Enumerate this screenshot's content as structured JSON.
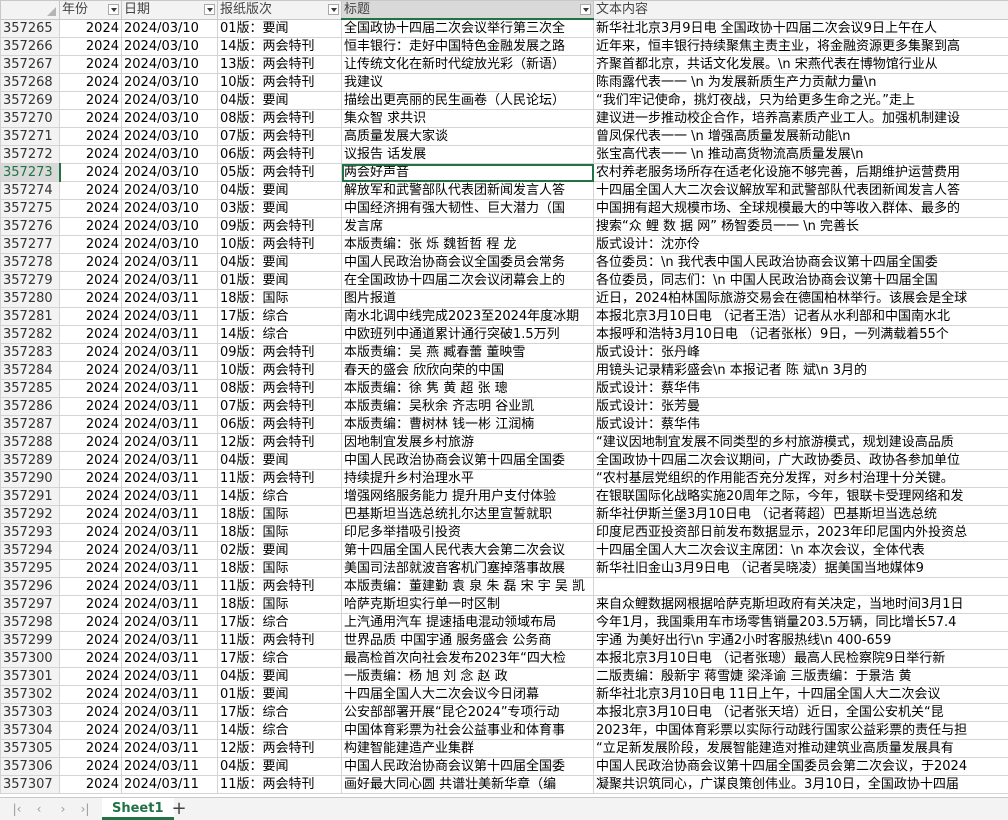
{
  "columns": [
    {
      "label": "年份",
      "filter": true
    },
    {
      "label": "日期",
      "filter": true
    },
    {
      "label": "报纸版次",
      "filter": true
    },
    {
      "label": "标题",
      "filter": true
    },
    {
      "label": "文本内容",
      "filter": false
    }
  ],
  "selected_row": "357273",
  "rows": [
    [
      "357265",
      "2024",
      "2024/03/10",
      "01版：要闻",
      "全国政协十四届二次会议举行第三次全",
      "新华社北京3月9日电  全国政协十四届二次会议9日上午在人"
    ],
    [
      "357266",
      "2024",
      "2024/03/10",
      "14版：两会特刊",
      "恒丰银行：走好中国特色金融发展之路",
      "近年来，恒丰银行持续聚焦主责主业，将金融资源更多集聚到高"
    ],
    [
      "357267",
      "2024",
      "2024/03/10",
      "13版：两会特刊",
      "让传统文化在新时代绽放光彩（新语）",
      "齐聚首都北京，共话文化发展。\\n  宋燕代表在博物馆行业从"
    ],
    [
      "357268",
      "2024",
      "2024/03/10",
      "10版：两会特刊",
      "我建议",
      "陈雨露代表一一  \\n  为发展新质生产力贡献力量\\n"
    ],
    [
      "357269",
      "2024",
      "2024/03/10",
      "04版：要闻",
      "描绘出更亮丽的民生画卷（人民论坛）",
      "“我们牢记使命，挑灯夜战，只为给更多生命之光。”走上"
    ],
    [
      "357270",
      "2024",
      "2024/03/10",
      "08版：两会特刊",
      "集众智  求共识",
      "建议进一步推动校企合作，培养高素质产业工人。加强机制建设"
    ],
    [
      "357271",
      "2024",
      "2024/03/10",
      "07版：两会特刊",
      "高质量发展大家谈",
      "曾凤保代表一一  \\n  增强高质量发展新动能\\n"
    ],
    [
      "357272",
      "2024",
      "2024/03/10",
      "06版：两会特刊",
      "议报告  话发展",
      "张宝高代表一一    \\n  推动高货物流高质量发展\\n"
    ],
    [
      "357273",
      "2024",
      "2024/03/10",
      "05版：两会特刊",
      "两会好声音",
      "农村养老服务场所存在适老化设施不够完善，后期维护运营费用"
    ],
    [
      "357274",
      "2024",
      "2024/03/10",
      "04版：要闻",
      "解放军和武警部队代表团新闻发言人答",
      "十四届全国人大二次会议解放军和武警部队代表团新闻发言人答"
    ],
    [
      "357275",
      "2024",
      "2024/03/10",
      "03版：要闻",
      "中国经济拥有强大韧性、巨大潜力（国",
      "中国拥有超大规模市场、全球规模最大的中等收入群体、最多的"
    ],
    [
      "357276",
      "2024",
      "2024/03/10",
      "09版：两会特刊",
      "发言席",
      "搜索“众 鲤 数 据 网” 杨智委员一一  \\n  完善长"
    ],
    [
      "357277",
      "2024",
      "2024/03/10",
      "10版：两会特刊",
      "本版责编：张  烁  魏哲哲  程  龙",
      "版式设计：沈亦伶"
    ],
    [
      "357278",
      "2024",
      "2024/03/11",
      "04版：要闻",
      "中国人民政治协商会议全国委员会常务",
      "各位委员：\\n  我代表中国人民政治协商会议第十四届全国委"
    ],
    [
      "357279",
      "2024",
      "2024/03/11",
      "01版：要闻",
      "在全国政协十四届二次会议闭幕会上的",
      "各位委员，同志们：\\n  中国人民政治协商会议第十四届全国"
    ],
    [
      "357280",
      "2024",
      "2024/03/11",
      "18版：国际",
      "图片报道",
      "近日，2024柏林国际旅游交易会在德国柏林举行。该展会是全球"
    ],
    [
      "357281",
      "2024",
      "2024/03/11",
      "17版：综合",
      "南水北调中线完成2023至2024年度冰期",
      "本报北京3月10日电  （记者王浩）记者从水利部和中国南水北"
    ],
    [
      "357282",
      "2024",
      "2024/03/11",
      "14版：综合",
      "中欧班列中通道累计通行突破1.5万列",
      "本报呼和浩特3月10日电  （记者张枨）9日，一列满载着55个"
    ],
    [
      "357283",
      "2024",
      "2024/03/11",
      "09版：两会特刊",
      "本版责编：吴  燕  臧春蕾  董映雪",
      "版式设计：张丹峰"
    ],
    [
      "357284",
      "2024",
      "2024/03/11",
      "10版：两会特刊",
      "春天的盛会  欣欣向荣的中国",
      "用镜头记录精彩盛会\\n  本报记者  陈  斌\\n  3月的"
    ],
    [
      "357285",
      "2024",
      "2024/03/11",
      "08版：两会特刊",
      "本版责编：徐  隽  黄  超  张  璁",
      "版式设计：蔡华伟"
    ],
    [
      "357286",
      "2024",
      "2024/03/11",
      "07版：两会特刊",
      "本版责编：吴秋余  齐志明  谷业凯",
      "版式设计：张芳曼"
    ],
    [
      "357287",
      "2024",
      "2024/03/11",
      "06版：两会特刊",
      "本版责编：曹树林  钱一彬  江润楠",
      "版式设计：蔡华伟"
    ],
    [
      "357288",
      "2024",
      "2024/03/11",
      "12版：两会特刊",
      "因地制宜发展乡村旅游",
      "“建议因地制宜发展不同类型的乡村旅游模式，规划建设高品质"
    ],
    [
      "357289",
      "2024",
      "2024/03/11",
      "04版：要闻",
      "中国人民政治协商会议第十四届全国委",
      "全国政协十四届二次会议期间，广大政协委员、政协各参加单位"
    ],
    [
      "357290",
      "2024",
      "2024/03/11",
      "11版：两会特刊",
      "持续提升乡村治理水平",
      "“农村基层党组织的作用能否充分发挥，对乡村治理十分关键。"
    ],
    [
      "357291",
      "2024",
      "2024/03/11",
      "14版：综合",
      "增强网络服务能力  提升用户支付体验",
      "在银联国际化战略实施20周年之际，今年，银联卡受理网络和发"
    ],
    [
      "357292",
      "2024",
      "2024/03/11",
      "18版：国际",
      "巴基斯坦当选总统扎尔达里宣誓就职",
      "新华社伊斯兰堡3月10日电  （记者蒋超）巴基斯坦当选总统"
    ],
    [
      "357293",
      "2024",
      "2024/03/11",
      "18版：国际",
      "印尼多举措吸引投资",
      "印度尼西亚投资部日前发布数据显示，2023年印尼国内外投资总"
    ],
    [
      "357294",
      "2024",
      "2024/03/11",
      "02版：要闻",
      "第十四届全国人民代表大会第二次会议",
      "十四届全国人大二次会议主席团：\\n  本次会议，全体代表"
    ],
    [
      "357295",
      "2024",
      "2024/03/11",
      "18版：国际",
      "美国司法部就波音客机门塞掉落事故展",
      "新华社旧金山3月9日电  （记者吴晓凌）据美国当地媒体9"
    ],
    [
      "357296",
      "2024",
      "2024/03/11",
      "11版：两会特刊",
      "本版责编：董建勤  袁  泉  朱  磊  宋  宇  吴  凯",
      ""
    ],
    [
      "357297",
      "2024",
      "2024/03/11",
      "18版：国际",
      "哈萨克斯坦实行单一时区制",
      "来自众鲤数据网根据哈萨克斯坦政府有关决定，当地时间3月1日"
    ],
    [
      "357298",
      "2024",
      "2024/03/11",
      "17版：综合",
      "上汽通用汽车  提速插电混动领域布局",
      "今年1月，我国乘用车市场零售销量203.5万辆，同比增长57.4"
    ],
    [
      "357299",
      "2024",
      "2024/03/11",
      "11版：两会特刊",
      "世界品质  中国宇通  服务盛会  公务商",
      "宇通  为美好出行\\n  宇通2小时客服热线\\n  400-659"
    ],
    [
      "357300",
      "2024",
      "2024/03/11",
      "17版：综合",
      "最高检首次向社会发布2023年“四大检",
      "本报北京3月10日电  （记者张璁）最高人民检察院9日举行新"
    ],
    [
      "357301",
      "2024",
      "2024/03/11",
      "04版：要闻",
      "一版责编：杨  旭  刘  念  赵  政",
      "二版责编：殷新宇  蒋雪婕  梁泽谕  三版责编：于景浩  黄"
    ],
    [
      "357302",
      "2024",
      "2024/03/11",
      "01版：要闻",
      "十四届全国人大二次会议今日闭幕",
      "新华社北京3月10日电  11日上午，十四届全国人大二次会议"
    ],
    [
      "357303",
      "2024",
      "2024/03/11",
      "17版：综合",
      "公安部部署开展“昆仑2024”专项行动",
      "本报北京3月10日电  （记者张天培）近日，全国公安机关“昆"
    ],
    [
      "357304",
      "2024",
      "2024/03/11",
      "14版：综合",
      "中国体育彩票为社会公益事业和体育事",
      "2023年，中国体育彩票以实际行动践行国家公益彩票的责任与担"
    ],
    [
      "357305",
      "2024",
      "2024/03/11",
      "12版：两会特刊",
      "构建智能建造产业集群",
      "“立足新发展阶段，发展智能建造对推动建筑业高质量发展具有"
    ],
    [
      "357306",
      "2024",
      "2024/03/11",
      "04版：要闻",
      "中国人民政治协商会议第十四届全国委",
      "中国人民政治协商会议第十四届全国委员会第二次会议，于2024"
    ],
    [
      "357307",
      "2024",
      "2024/03/11",
      "11版：两会特刊",
      "画好最大同心圆  共谱壮美新华章（编",
      "凝聚共识筑同心，广谋良策创伟业。3月10日，全国政协十四届"
    ]
  ],
  "bottom_bar": {
    "nav": [
      "first-sheet",
      "prev-sheet",
      "next-sheet",
      "last-sheet"
    ],
    "sheet_tab": "Sheet1",
    "add_sheet": "+"
  },
  "colors": {
    "accent": "#217346",
    "header_bg": "#f3f3f3",
    "gridline": "#d4d4d4"
  }
}
